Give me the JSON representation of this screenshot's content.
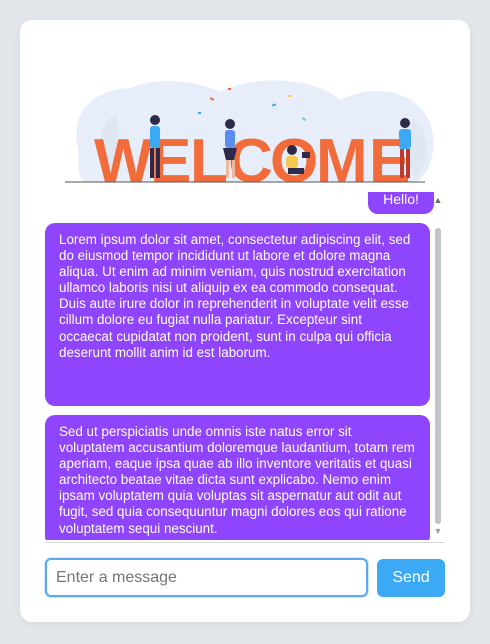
{
  "banner": {
    "letters": [
      "W",
      "E",
      "L",
      "C",
      "O",
      "M",
      "E"
    ],
    "alt": "WELCOME"
  },
  "messages": [
    {
      "role": "user",
      "text": "Hello!"
    },
    {
      "role": "bot",
      "text": "Lorem ipsum dolor sit amet, consectetur adipiscing elit, sed do eiusmod tempor incididunt ut labore et dolore magna aliqua. Ut enim ad minim veniam, quis nostrud exercitation ullamco laboris nisi ut aliquip ex ea commodo consequat. Duis aute irure dolor in reprehenderit in voluptate velit esse cillum dolore eu fugiat nulla pariatur. Excepteur sint occaecat cupidatat non proident, sunt in culpa qui officia deserunt mollit anim id est laborum."
    },
    {
      "role": "bot",
      "text": "Sed ut perspiciatis unde omnis iste natus error sit voluptatem accusantium doloremque laudantium, totam rem aperiam, eaque ipsa quae ab illo inventore veritatis et quasi architecto beatae vitae dicta sunt explicabo. Nemo enim ipsam voluptatem quia voluptas sit aspernatur aut odit aut fugit, sed quia consequuntur magni dolores eos qui ratione voluptatem sequi nesciunt."
    }
  ],
  "composer": {
    "placeholder": "Enter a message",
    "send_label": "Send"
  },
  "colors": {
    "bubble": "#8f44fd",
    "send": "#3ba9f3",
    "banner_letters": "#f26b3a",
    "input_border": "#5aa9f0"
  }
}
